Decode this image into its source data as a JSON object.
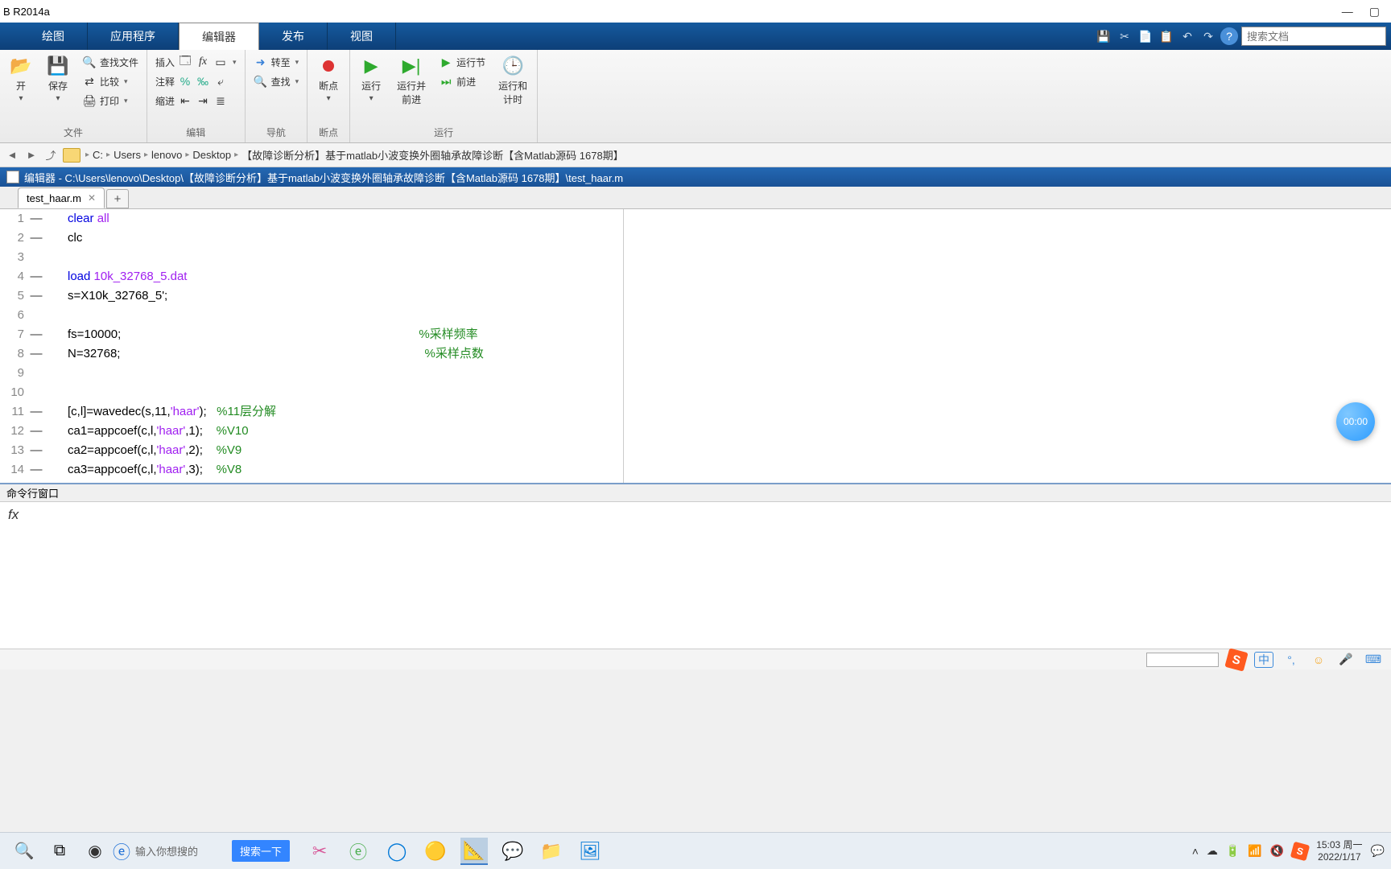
{
  "title": "B R2014a",
  "windowControls": {
    "min": "—",
    "max": "▢",
    "close": ""
  },
  "ribbonTabs": {
    "t1": "绘图",
    "t2": "应用程序",
    "t3": "编辑器",
    "t4": "发布",
    "t5": "视图"
  },
  "searchDocPlaceholder": "搜索文档",
  "ribbon": {
    "open": "开",
    "save": "保存",
    "findFiles": "查找文件",
    "compare": "比较",
    "print": "打印",
    "insert": "插入",
    "comment": "注释",
    "indent": "缩进",
    "goto": "转至",
    "find": "查找",
    "breakpoint": "断点",
    "run": "运行",
    "runAdvance": "运行并\n前进",
    "runSection": "运行节",
    "advance": "前进",
    "runTime": "运行和\n计时",
    "g_file": "文件",
    "g_edit": "编辑",
    "g_nav": "导航",
    "g_break": "断点",
    "g_run": "运行",
    "fx": "fx"
  },
  "breadcrumbs": {
    "p1": "C:",
    "p2": "Users",
    "p3": "lenovo",
    "p4": "Desktop",
    "p5": "【故障诊断分析】基于matlab小波变换外圈轴承故障诊断【含Matlab源码 1678期】"
  },
  "editorTitle": "编辑器 - C:\\Users\\lenovo\\Desktop\\【故障诊断分析】基于matlab小波变换外圈轴承故障诊断【含Matlab源码 1678期】\\test_haar.m",
  "fileTab": "test_haar.m",
  "code": {
    "l1a": "clear ",
    "l1b": "all",
    "l2": "clc",
    "l4a": "load ",
    "l4b": "10k_32768_5.dat",
    "l5": "s=X10k_32768_5';",
    "l7a": "fs=10000;",
    "l7c": "%采样频率",
    "l8a": "N=32768;",
    "l8c": "%采样点数",
    "l11a": "[c,l]=wavedec(s,11,",
    "l11b": "'haar'",
    "l11c": ");   ",
    "l11d": "%11层分解",
    "l12a": "ca1=appcoef(c,l,",
    "l12b": "'haar'",
    "l12c": ",1);    ",
    "l12d": "%V10",
    "l13a": "ca2=appcoef(c,l,",
    "l13b": "'haar'",
    "l13c": ",2);    ",
    "l13d": "%V9",
    "l14a": "ca3=appcoef(c,l,",
    "l14b": "'haar'",
    "l14c": ",3);    ",
    "l14d": "%V8"
  },
  "lineNumbers": [
    "1",
    "2",
    "3",
    "4",
    "5",
    "6",
    "7",
    "8",
    "9",
    "10",
    "11",
    "12",
    "13",
    "14"
  ],
  "marks": [
    "—",
    "—",
    "",
    "—",
    "—",
    "",
    "—",
    "—",
    "",
    "",
    "—",
    "—",
    "—",
    "—"
  ],
  "cmdWinTitle": "命令行窗口",
  "cmdPrompt": "fx",
  "timer": "00:00",
  "taskbar": {
    "searchHint": "输入你想搜的",
    "searchBtn": "搜索一下",
    "ime": "中",
    "time": "15:03 周一",
    "date": "2022/1/17",
    "sogou": "S"
  }
}
